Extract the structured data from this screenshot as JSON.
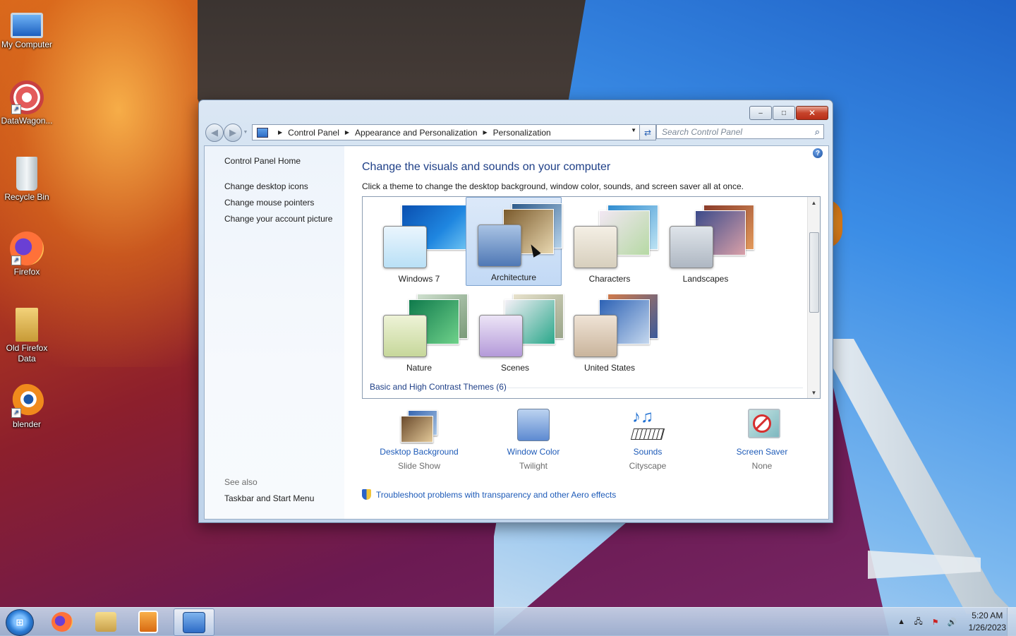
{
  "desktop": {
    "icons": [
      {
        "label": "My Computer"
      },
      {
        "label": "DataWagon..."
      },
      {
        "label": "Recycle Bin"
      },
      {
        "label": "Firefox"
      },
      {
        "label": "Old Firefox Data"
      },
      {
        "label": "blender"
      }
    ]
  },
  "window": {
    "address": {
      "crumbs": [
        "Control Panel",
        "Appearance and Personalization",
        "Personalization"
      ]
    },
    "search_placeholder": "Search Control Panel",
    "caption": {
      "minimize": "–",
      "maximize": "□",
      "close": "✕"
    },
    "left_pane": {
      "home": "Control Panel Home",
      "links": [
        "Change desktop icons",
        "Change mouse pointers",
        "Change your account picture"
      ],
      "see_also": "See also",
      "see_also_links": [
        "Taskbar and Start Menu"
      ]
    },
    "main": {
      "title": "Change the visuals and sounds on your computer",
      "subtitle": "Click a theme to change the desktop background, window color, sounds, and screen saver all at once.",
      "themes": [
        {
          "label": "Windows 7",
          "selected": false
        },
        {
          "label": "Architecture",
          "selected": true
        },
        {
          "label": "Characters",
          "selected": false
        },
        {
          "label": "Landscapes",
          "selected": false
        },
        {
          "label": "Nature",
          "selected": false
        },
        {
          "label": "Scenes",
          "selected": false
        },
        {
          "label": "United States",
          "selected": false
        }
      ],
      "basic_heading": "Basic and High Contrast Themes (6)",
      "settings": [
        {
          "label": "Desktop Background",
          "value": "Slide Show",
          "icon": "desktop-background-icon"
        },
        {
          "label": "Window Color",
          "value": "Twilight",
          "icon": "window-color-icon"
        },
        {
          "label": "Sounds",
          "value": "Cityscape",
          "icon": "sounds-icon"
        },
        {
          "label": "Screen Saver",
          "value": "None",
          "icon": "screen-saver-icon"
        }
      ],
      "troubleshoot": "Troubleshoot problems with transparency and other Aero effects"
    }
  },
  "taskbar": {
    "clock": {
      "time": "5:20 AM",
      "date": "1/26/2023"
    }
  }
}
